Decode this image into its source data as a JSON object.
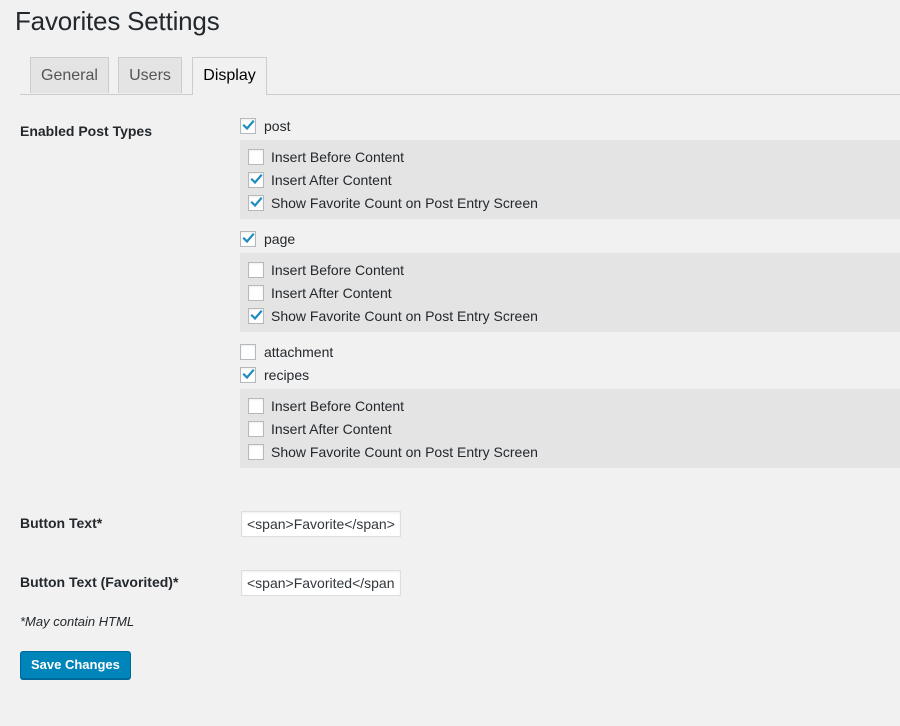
{
  "page": {
    "title": "Favorites Settings"
  },
  "tabs": [
    {
      "label": "General",
      "active": false
    },
    {
      "label": "Users",
      "active": false
    },
    {
      "label": "Display",
      "active": true
    }
  ],
  "enabled_post_types": {
    "label": "Enabled Post Types",
    "types": [
      {
        "name": "post",
        "checked": true,
        "options": [
          {
            "label": "Insert Before Content",
            "checked": false
          },
          {
            "label": "Insert After Content",
            "checked": true
          },
          {
            "label": "Show Favorite Count on Post Entry Screen",
            "checked": true
          }
        ]
      },
      {
        "name": "page",
        "checked": true,
        "options": [
          {
            "label": "Insert Before Content",
            "checked": false
          },
          {
            "label": "Insert After Content",
            "checked": false
          },
          {
            "label": "Show Favorite Count on Post Entry Screen",
            "checked": true
          }
        ]
      },
      {
        "name": "attachment",
        "checked": false,
        "options": []
      },
      {
        "name": "recipes",
        "checked": true,
        "options": [
          {
            "label": "Insert Before Content",
            "checked": false
          },
          {
            "label": "Insert After Content",
            "checked": false
          },
          {
            "label": "Show Favorite Count on Post Entry Screen",
            "checked": false
          }
        ]
      }
    ]
  },
  "button_text": {
    "label": "Button Text*",
    "value": "<span>Favorite</span>"
  },
  "button_text_favorited": {
    "label": "Button Text (Favorited)*",
    "value": "<span>Favorited</span>"
  },
  "note": "*May contain HTML",
  "save_button": {
    "label": "Save Changes"
  },
  "colors": {
    "accent": "#0085ba",
    "checkmark": "#1e8cbe",
    "panel": "#e4e4e4",
    "background": "#f1f1f1"
  }
}
